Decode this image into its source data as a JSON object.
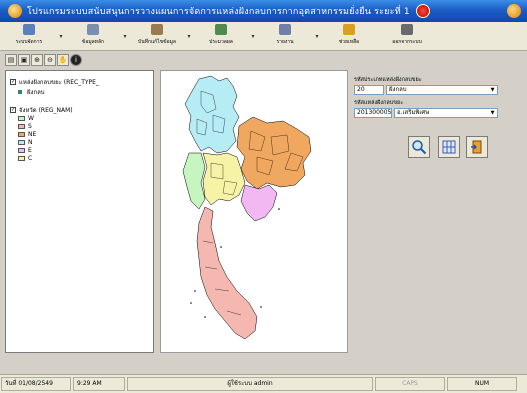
{
  "window": {
    "title": "โปรแกรมระบบสนับสนุนการวางแผนการจัดการแหล่งฝังกลบการกากอุตสาหกรรมยั่งยืน ระยะที่ 1"
  },
  "toolbar": {
    "buttons": [
      {
        "label": "ระบบจัดการ",
        "icon": "system-icon"
      },
      {
        "label": "ข้อมูลหลัก",
        "icon": "database-icon"
      },
      {
        "label": "บันทึกแก้ไขข้อมูล",
        "icon": "edit-icon"
      },
      {
        "label": "ประมวลผล",
        "icon": "process-icon"
      },
      {
        "label": "รายงาน",
        "icon": "report-icon"
      },
      {
        "label": "ช่วยเหลือ",
        "icon": "help-icon"
      },
      {
        "label": "ออกจากระบบ",
        "icon": "exit-icon"
      }
    ]
  },
  "map_tools": [
    "print-icon",
    "save-icon",
    "zoom-in-icon",
    "zoom-out-icon",
    "pan-icon",
    "info-icon"
  ],
  "legend": {
    "layer1": {
      "label": "แหล่งฝังกลบขยะ (REC_TYPE_",
      "items": [
        {
          "label": "ฝังกลบ",
          "color": "#2e8b57"
        }
      ]
    },
    "layer2": {
      "label": "จังหวัด (REG_NAM)",
      "items": [
        {
          "label": "W",
          "color": "#c6f5c0"
        },
        {
          "label": "S",
          "color": "#f4b8b0"
        },
        {
          "label": "NE",
          "color": "#f0a860"
        },
        {
          "label": "N",
          "color": "#b6ecf4"
        },
        {
          "label": "E",
          "color": "#f2b8f2"
        },
        {
          "label": "C",
          "color": "#f7f3a6"
        }
      ]
    }
  },
  "search_panel": {
    "type_label": "รหัสประเภทแหล่งฝังกลบขยะ",
    "type_code": "20",
    "type_value": "ฝังกลบ",
    "site_label": "รหัสแหล่งฝังกลบขยะ",
    "site_code": "201300005",
    "site_value": "อ.เสริมพิเศษ"
  },
  "status": {
    "date": "วันที่ 01/08/2549",
    "time": "9:29 AM",
    "user": "ผู้ใช้ระบบ admin",
    "caps": "CAPS",
    "num": "NUM"
  },
  "colors": {
    "title_blue": "#1c5ec6",
    "west": "#c6f5c0",
    "south": "#f4b8b0",
    "northeast": "#f0a860",
    "north": "#b6ecf4",
    "east": "#f2b8f2",
    "central": "#f7f3a6"
  }
}
